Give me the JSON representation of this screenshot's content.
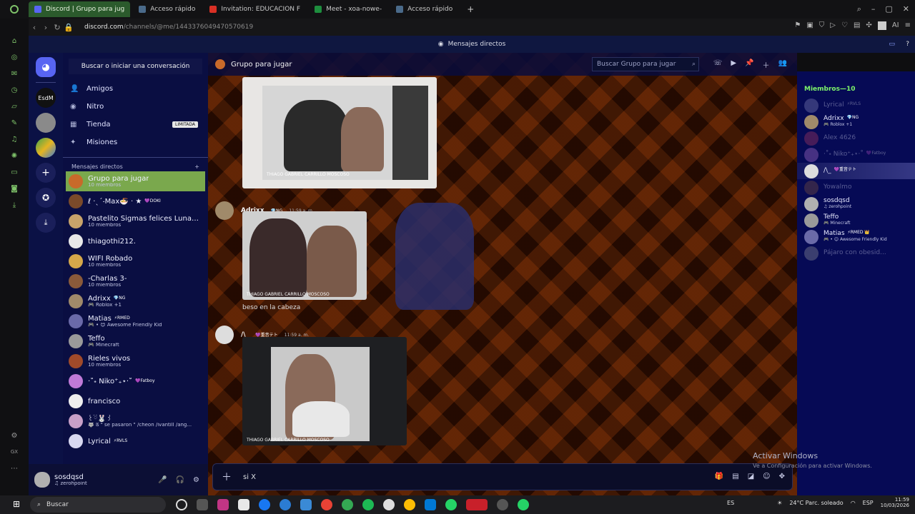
{
  "browser": {
    "tabs": [
      {
        "label": "Discord | Grupo para jug",
        "active": true,
        "color": "#5865f2"
      },
      {
        "label": "Acceso rápido",
        "active": false,
        "color": "#4a6a8a"
      },
      {
        "label": "Invitation: EDUCACION F",
        "active": false,
        "color": "#d93025"
      },
      {
        "label": "Meet - xoa-nowe-",
        "active": false,
        "color": "#1e8e3e"
      },
      {
        "label": "Acceso rápido",
        "active": false,
        "color": "#4a6a8a"
      }
    ],
    "url_host": "discord.com",
    "url_path": "/channels/@me/1443376049470570619"
  },
  "discord": {
    "top_label": "Mensajes directos",
    "search_placeholder": "Buscar o iniciar una conversación",
    "menu": [
      {
        "label": "Amigos",
        "icon": "friends-icon"
      },
      {
        "label": "Nitro",
        "icon": "nitro-icon"
      },
      {
        "label": "Tienda",
        "icon": "shop-icon",
        "badge": "LIMITADA"
      },
      {
        "label": "Misiones",
        "icon": "quests-icon"
      }
    ],
    "dm_header": "Mensajes directos",
    "dm_add": "+",
    "dms": [
      {
        "name": "Grupo para jugar",
        "sub": "10 miembros",
        "color": "#c86a2a",
        "selected": true
      },
      {
        "name": "ℓ ·ˎˊ˗Max🍜 · ★",
        "sub": "",
        "tag": "💜DOKI",
        "color": "#7a4a2a"
      },
      {
        "name": "Pastelito Sigmas felices Lunati...",
        "sub": "10 miembros",
        "color": "#c9a46a"
      },
      {
        "name": "thiagothi212.",
        "sub": "",
        "color": "#e8e8e8"
      },
      {
        "name": "WIFI Robado",
        "sub": "10 miembros",
        "color": "#d6a84a"
      },
      {
        "name": "-Charlas 3-",
        "sub": "10 miembros",
        "color": "#8a5a3a"
      },
      {
        "name": "Adrixx",
        "sub": "🎮 Roblox +1",
        "tag": "💎NG",
        "color": "#a08a6a"
      },
      {
        "name": "Matias",
        "sub": "🎮 • 😊 Awesome Friendly Kid",
        "tag": "⚡RMED",
        "color": "#6a6aa8"
      },
      {
        "name": "Teffo",
        "sub": "🎮 Minecraft",
        "color": "#9a9a9a"
      },
      {
        "name": "Rieles vivos",
        "sub": "10 miembros",
        "color": "#a04a2a"
      },
      {
        "name": "·˚˖ Niko⁺₊⋆·˚",
        "sub": "",
        "tag": "💜Fatboy",
        "color": "#c07ad8"
      },
      {
        "name": "francisco",
        "sub": "",
        "color": "#eeeeee"
      },
      {
        "name": "꒰ྀི🐰꒱",
        "sub": "🐺 ß \" se pasaron \" /cheon /ivantill /ang...",
        "color": "#c8a0c8"
      },
      {
        "name": "Lyrical",
        "sub": "",
        "tag": "⚡RVLS",
        "color": "#d8d8f0"
      }
    ],
    "user": {
      "name": "sosdqsd",
      "status": "♫ zerohpoint"
    },
    "channel_title": "Grupo para jugar",
    "channel_search": "Buscar Grupo para jugar",
    "messages": [
      {
        "author": "Adrixx",
        "tag": "💎NG",
        "time": "11:59 a. m.",
        "text": "beso en la cabeza"
      },
      {
        "author": "/\\_",
        "tag": "💜重音テト",
        "time": "11:59 a. m.",
        "text": ""
      }
    ],
    "video_labels": [
      "THIAGO GABRIEL CARRILLO MOSCOSO",
      "THIAGO GABRIEL CARRILLO MOSCOSO",
      "THIAGO GABRIEL CARRILLO MOSCOSO"
    ],
    "composer_value": "si X",
    "members_header": "Miembros—10",
    "members": [
      {
        "name": "Lyrical",
        "sub": "",
        "tag": "⚡RVLS",
        "dim": true,
        "color": "#9090c0"
      },
      {
        "name": "Adrixx",
        "sub": "🎮 Roblox +1",
        "tag": "💎NG",
        "dim": false,
        "color": "#a08a6a"
      },
      {
        "name": "Alex 4626",
        "sub": "",
        "tag": "",
        "dim": true,
        "color": "#c04060"
      },
      {
        "name": "·˚˖ Niko⁺₊⋆·˚",
        "sub": "",
        "tag": "💜Fatboy",
        "dim": true,
        "color": "#c07ad8"
      },
      {
        "name": "/\\_",
        "sub": "",
        "tag": "💜重音テト",
        "dim": false,
        "color": "#dddddd",
        "highlight": true
      },
      {
        "name": "Yowalmo",
        "sub": "",
        "tag": "",
        "dim": true,
        "color": "#8a5a3a"
      },
      {
        "name": "sosdqsd",
        "sub": "♫ zerohpoint",
        "tag": "",
        "dim": false,
        "color": "#b0b0b0"
      },
      {
        "name": "Teffo",
        "sub": "🎮 Minecraft",
        "tag": "",
        "dim": false,
        "color": "#9a9a9a"
      },
      {
        "name": "Matias",
        "sub": "🎮 • 😊 Awesome Friendly Kid",
        "tag": "⚡RMED 👑",
        "dim": false,
        "color": "#6a6aa8"
      },
      {
        "name": "Pájaro con obesid...",
        "sub": "",
        "tag": "",
        "dim": true,
        "color": "#a0a0a0"
      }
    ],
    "activation_title": "Activar Windows",
    "activation_sub": "Ve a Configuración para activar Windows."
  },
  "taskbar": {
    "search": "Buscar",
    "lang": "ES",
    "weather": "24°C  Parc. soleado",
    "kbd": "ESP",
    "time": "11:59",
    "date": "10/03/2026"
  }
}
